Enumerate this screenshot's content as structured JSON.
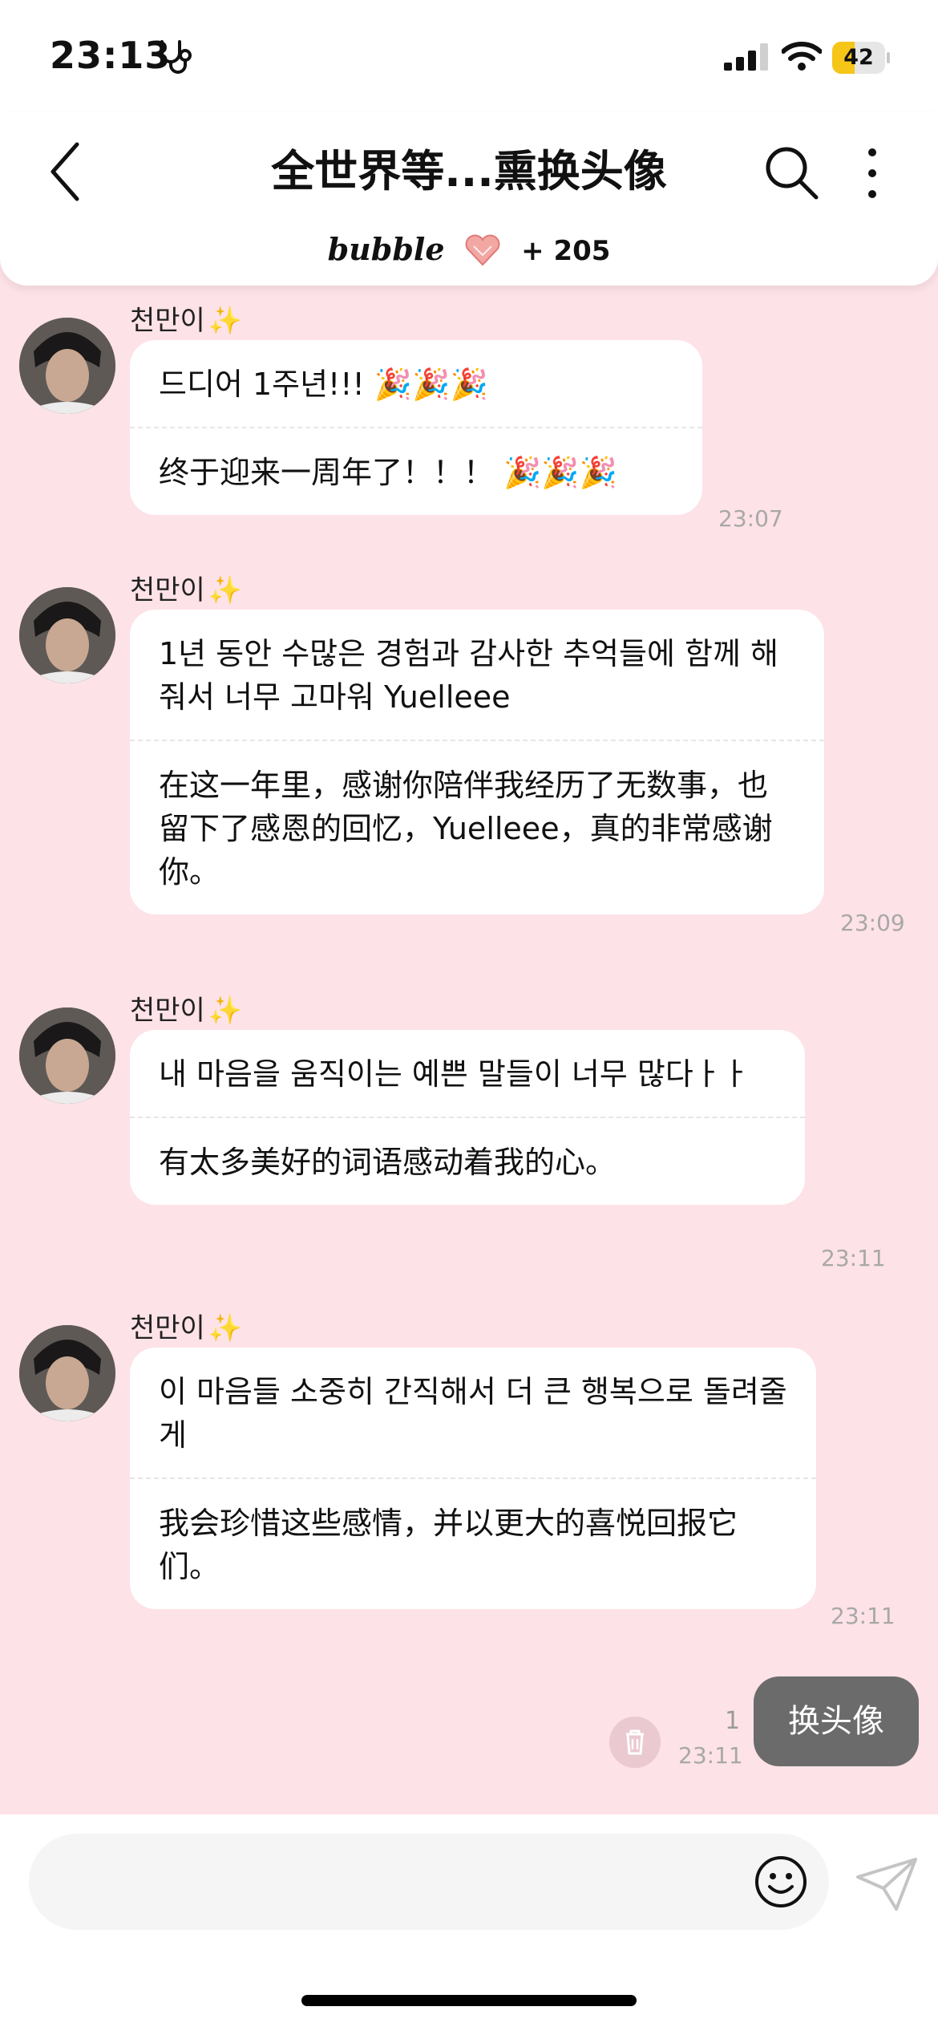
{
  "status_bar": {
    "time": "23:13",
    "battery_level": "42",
    "battery_fraction": 0.42,
    "battery_color": "#f5c518"
  },
  "header": {
    "title": "全世界等...熏换头像",
    "bubble_brand": "bubble",
    "bubble_count": "+ 205"
  },
  "messages": [
    {
      "sender": "천만이",
      "segments": [
        {
          "text": "드디어 1주년!!!",
          "emoji": "🎉🎉🎉"
        },
        {
          "text": "终于迎来一周年了！！！",
          "emoji": "🎉🎉🎉"
        }
      ],
      "time": "23:07"
    },
    {
      "sender": "천만이",
      "segments": [
        {
          "text": "1년 동안 수많은 경험과 감사한 추억들에 함께 해 줘서 너무 고마워 Yuelleee"
        },
        {
          "text": "在这一年里，感谢你陪伴我经历了无数事，也留下了感恩的回忆，Yuelleee，真的非常感谢你。"
        }
      ],
      "time": "23:09"
    },
    {
      "sender": "천만이",
      "segments": [
        {
          "text": "내 마음을 움직이는 예쁜 말들이 너무 많다ㅏㅏ"
        },
        {
          "text": "有太多美好的词语感动着我的心。"
        }
      ],
      "time": "23:11"
    },
    {
      "sender": "천만이",
      "segments": [
        {
          "text": "이 마음들 소중히 간직해서 더 큰 행복으로 돌려줄게"
        },
        {
          "text": "我会珍惜这些感情，并以更大的喜悦回报它们。"
        }
      ],
      "time": "23:11"
    }
  ],
  "sent_message": {
    "text": "换头像",
    "read_count": "1",
    "time": "23:11"
  },
  "composer": {
    "placeholder": ""
  },
  "colors": {
    "background": "#fde2e7",
    "sent_bubble": "#6b6b6b",
    "sparkle": "#f0c419"
  }
}
